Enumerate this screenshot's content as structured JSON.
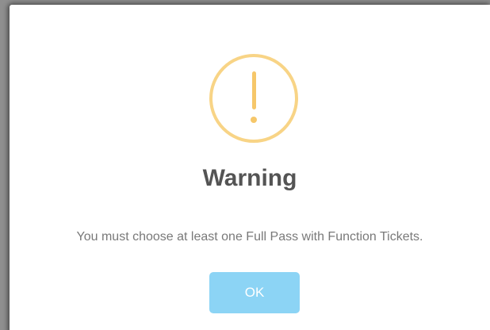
{
  "dialog": {
    "icon": "warning-exclamation-icon",
    "title": "Warning",
    "message": "You must choose at least one Full Pass with Function Tickets.",
    "confirm_label": "OK"
  },
  "colors": {
    "icon_ring": "#f8d486",
    "icon_mark": "#f6c76a",
    "title_text": "#545454",
    "message_text": "#797979",
    "confirm_button": "#8cd4f5",
    "confirm_text": "#ffffff"
  }
}
